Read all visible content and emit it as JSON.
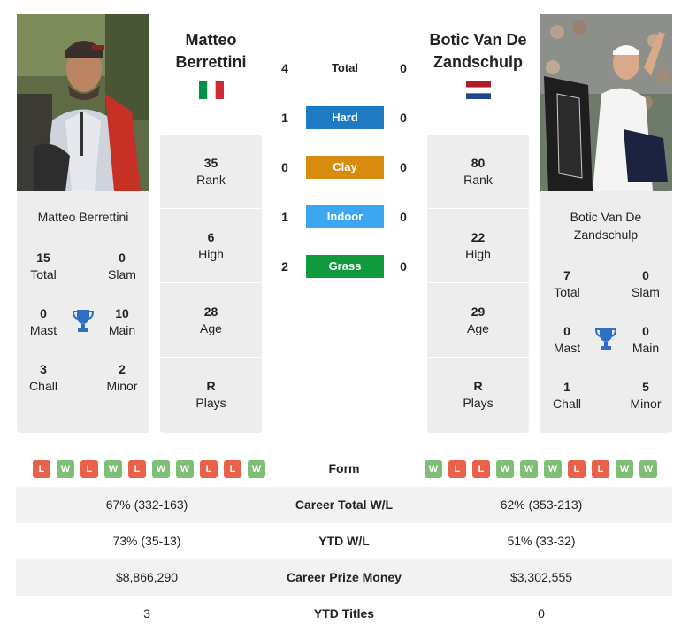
{
  "colors": {
    "hard": "#1f7ac4",
    "clay": "#d98b0f",
    "indoor": "#3ca6f0",
    "grass": "#119a3d",
    "trophy": "#2e6fc4",
    "win": "#7dbf74",
    "loss": "#e8614a"
  },
  "player1": {
    "name": "Matteo Berrettini",
    "flag": "italy-flag",
    "stats": {
      "total": "15",
      "total_label": "Total",
      "slam": "0",
      "slam_label": "Slam",
      "mast": "0",
      "mast_label": "Mast",
      "main": "10",
      "main_label": "Main",
      "chall": "3",
      "chall_label": "Chall",
      "minor": "2",
      "minor_label": "Minor"
    },
    "info": {
      "rank": "35",
      "rank_label": "Rank",
      "high": "6",
      "high_label": "High",
      "age": "28",
      "age_label": "Age",
      "plays": "R",
      "plays_label": "Plays"
    },
    "form": [
      "L",
      "W",
      "L",
      "W",
      "L",
      "W",
      "W",
      "L",
      "L",
      "W"
    ],
    "career_wl": "67% (332-163)",
    "ytd_wl": "73% (35-13)",
    "prize": "$8,866,290",
    "ytd_titles": "3"
  },
  "player2": {
    "name_line1": "Botic Van De",
    "name_line2": "Zandschulp",
    "flag": "netherlands-flag",
    "stats": {
      "total": "7",
      "total_label": "Total",
      "slam": "0",
      "slam_label": "Slam",
      "mast": "0",
      "mast_label": "Mast",
      "main": "0",
      "main_label": "Main",
      "chall": "1",
      "chall_label": "Chall",
      "minor": "5",
      "minor_label": "Minor"
    },
    "info": {
      "rank": "80",
      "rank_label": "Rank",
      "high": "22",
      "high_label": "High",
      "age": "29",
      "age_label": "Age",
      "plays": "R",
      "plays_label": "Plays"
    },
    "form": [
      "W",
      "L",
      "L",
      "W",
      "W",
      "W",
      "L",
      "L",
      "W",
      "W"
    ],
    "career_wl": "62% (353-213)",
    "ytd_wl": "51% (33-32)",
    "prize": "$3,302,555",
    "ytd_titles": "0"
  },
  "h2h": {
    "total": {
      "label": "Total",
      "p1": "4",
      "p2": "0"
    },
    "hard": {
      "label": "Hard",
      "p1": "1",
      "p2": "0"
    },
    "clay": {
      "label": "Clay",
      "p1": "0",
      "p2": "0"
    },
    "indoor": {
      "label": "Indoor",
      "p1": "1",
      "p2": "0"
    },
    "grass": {
      "label": "Grass",
      "p1": "2",
      "p2": "0"
    }
  },
  "table": {
    "form_label": "Form",
    "career_wl_label": "Career Total W/L",
    "ytd_wl_label": "YTD W/L",
    "prize_label": "Career Prize Money",
    "ytd_titles_label": "YTD Titles"
  }
}
